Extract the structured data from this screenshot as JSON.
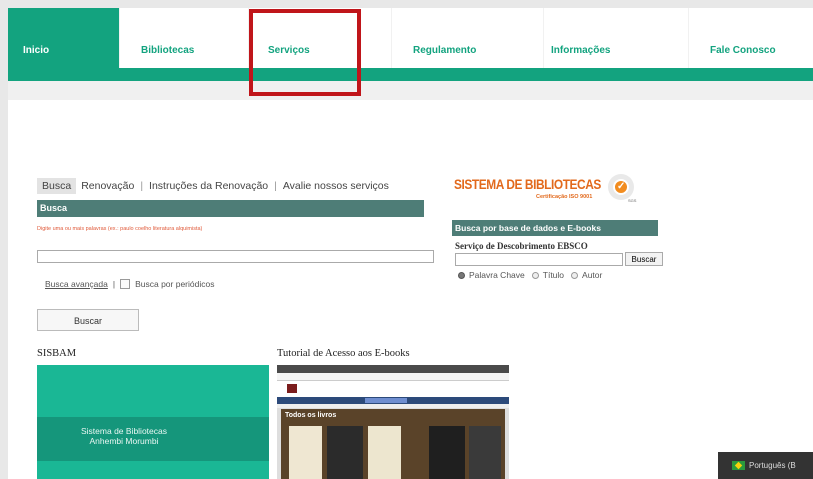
{
  "nav": {
    "items": [
      {
        "label": "Inicio",
        "active": true
      },
      {
        "label": "Bibliotecas",
        "active": false
      },
      {
        "label": "Serviços",
        "active": false
      },
      {
        "label": "Regulamento",
        "active": false
      },
      {
        "label": "Informações",
        "active": false
      },
      {
        "label": "Fale Conosco",
        "active": false
      }
    ]
  },
  "tabs": [
    {
      "label": "Busca",
      "active": true
    },
    {
      "label": "Renovação",
      "active": false
    },
    {
      "label": "Instruções da Renovação",
      "active": false
    },
    {
      "label": "Avalie nossos serviços",
      "active": false
    }
  ],
  "busca": {
    "header": "Busca",
    "hint": "Digite uma ou mais palavras (ex.: paulo coelho literatura alquimista)",
    "input_value": "",
    "advanced_link": "Busca avançada",
    "separator": "|",
    "periodicos_label": "Busca por periódicos",
    "button": "Buscar"
  },
  "sisbam": {
    "label": "SISBAM",
    "banner_line1": "Sistema de Bibliotecas",
    "banner_line2": "Anhembi Morumbi"
  },
  "tutorial": {
    "label": "Tutorial de Acesso aos E-books",
    "shot_title": "Todos os livros"
  },
  "logo": {
    "title": "SISTEMA DE BIBLIOTECAS",
    "subtitle": "Certificação ISO 9001",
    "seal_mark": "SGS"
  },
  "ebsco": {
    "header": "Busca por base de dados e E-books",
    "subtitle": "Serviço de Descobrimento EBSCO",
    "input_value": "",
    "button": "Buscar",
    "options": [
      {
        "label": "Palavra Chave",
        "selected": true
      },
      {
        "label": "Título",
        "selected": false
      },
      {
        "label": "Autor",
        "selected": false
      }
    ]
  },
  "language": {
    "label": "Português (B"
  },
  "colors": {
    "brand_green": "#13a37f",
    "header_teal": "#4e7d77",
    "highlight_red": "#c0151a",
    "logo_orange": "#e2691c"
  }
}
